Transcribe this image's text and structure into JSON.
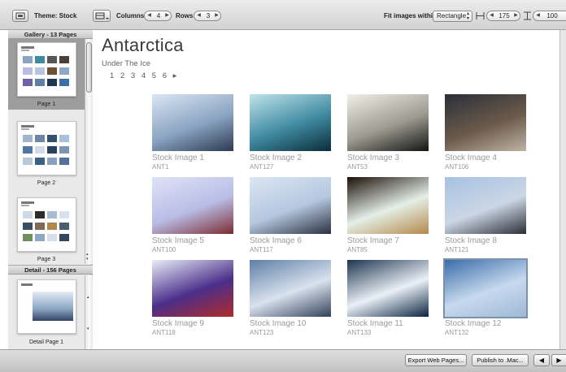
{
  "toolbar": {
    "theme_label": "Theme: Stock",
    "columns_label": "Columns:",
    "columns_value": "4",
    "rows_label": "Rows:",
    "rows_value": "3",
    "fit_label": "Fit images within:",
    "fit_value": "Rectangle",
    "width_value": "175",
    "height_value": "100"
  },
  "sidebar": {
    "gallery_header": "Gallery - 13 Pages",
    "gallery_pages": [
      {
        "label": "Page 1",
        "selected": true
      },
      {
        "label": "Page 2",
        "selected": false
      },
      {
        "label": "Page 3",
        "selected": false
      }
    ],
    "detail_header": "Detail - 156 Pages",
    "detail_pages": [
      {
        "label": "Detail Page 1"
      }
    ]
  },
  "page": {
    "title": "Antarctica",
    "subtitle": "Under The Ice",
    "pages": [
      "1",
      "2",
      "3",
      "4",
      "5",
      "6"
    ],
    "next_arrow": "▸"
  },
  "images": [
    {
      "title": "Stock Image 1",
      "code": "ANT1",
      "colors": [
        "#dbe6f4",
        "#8aa4c2",
        "#2c3a52"
      ]
    },
    {
      "title": "Stock Image 2",
      "code": "ANT127",
      "colors": [
        "#bfe3ea",
        "#3f8aa1",
        "#0b2c39"
      ]
    },
    {
      "title": "Stock Image 3",
      "code": "ANT53",
      "colors": [
        "#f0f0e8",
        "#9b9b90",
        "#141414"
      ]
    },
    {
      "title": "Stock Image 4",
      "code": "ANT106",
      "colors": [
        "#2a2f3a",
        "#6b5a4a",
        "#bfb3a6"
      ]
    },
    {
      "title": "Stock Image 5",
      "code": "ANT100",
      "colors": [
        "#dfe3f6",
        "#b9bde6",
        "#7c2b31"
      ]
    },
    {
      "title": "Stock Image 6",
      "code": "ANT117",
      "colors": [
        "#dbe6f3",
        "#b5c7df",
        "#2a3040"
      ]
    },
    {
      "title": "Stock Image 7",
      "code": "ANT85",
      "colors": [
        "#1b0f08",
        "#e4efe8",
        "#b4884a"
      ]
    },
    {
      "title": "Stock Image 8",
      "code": "ANT121",
      "colors": [
        "#a7c2e2",
        "#cbd6e5",
        "#2b2e35"
      ]
    },
    {
      "title": "Stock Image 9",
      "code": "ANT118",
      "colors": [
        "#e9eef8",
        "#4b2f8a",
        "#b12a2a"
      ]
    },
    {
      "title": "Stock Image 10",
      "code": "ANT123",
      "colors": [
        "#5e7fa6",
        "#d9e2ee",
        "#31415a"
      ]
    },
    {
      "title": "Stock Image 11",
      "code": "ANT133",
      "colors": [
        "#1d3550",
        "#eaf0f6",
        "#0a2442"
      ]
    },
    {
      "title": "Stock Image 12",
      "code": "ANT132",
      "colors": [
        "#3a6da9",
        "#c7d9ee",
        "#9fb8d6"
      ],
      "selected": true
    }
  ],
  "bottombar": {
    "export_label": "Export Web Pages...",
    "publish_label": "Publish to .Mac..."
  },
  "colors": {
    "title_text": "#3b3b3b",
    "caption_text": "#9a9a9a",
    "selection_ring": "#7b93aa"
  }
}
